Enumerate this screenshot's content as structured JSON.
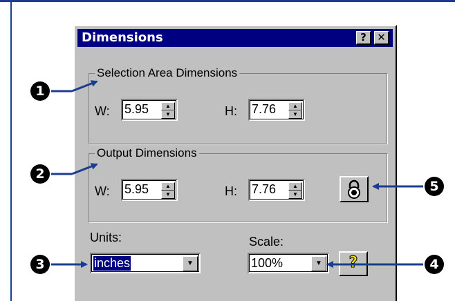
{
  "window": {
    "title": "Dimensions",
    "help_button": "?",
    "close_button": "✕"
  },
  "selection_area": {
    "legend": "Selection Area Dimensions",
    "width_label": "W:",
    "width_value": "5.95",
    "height_label": "H:",
    "height_value": "7.76"
  },
  "output": {
    "legend": "Output Dimensions",
    "width_label": "W:",
    "width_value": "5.95",
    "height_label": "H:",
    "height_value": "7.76"
  },
  "units": {
    "label": "Units:",
    "value": "inches"
  },
  "scale": {
    "label": "Scale:",
    "value": "100%"
  },
  "callouts": [
    "1",
    "2",
    "3",
    "4",
    "5"
  ],
  "colors": {
    "callout_arrow": "#1a3d8f",
    "title_bar": "#000080",
    "dialog_bg": "#c0c0c0"
  },
  "icons": {
    "lock": "padlock-icon",
    "help": "question-mark-icon"
  }
}
